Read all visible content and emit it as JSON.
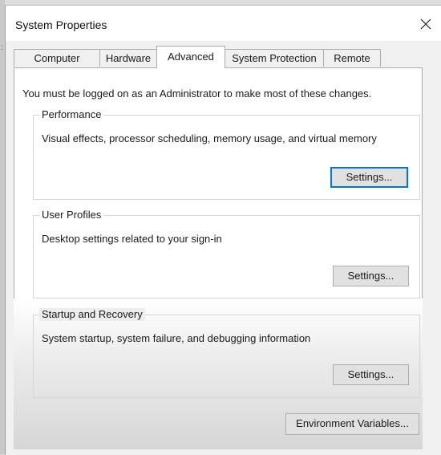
{
  "window": {
    "title": "System Properties",
    "close_icon": "close-icon"
  },
  "tabs": [
    {
      "label": "Computer Name",
      "active": false
    },
    {
      "label": "Hardware",
      "active": false
    },
    {
      "label": "Advanced",
      "active": true
    },
    {
      "label": "System Protection",
      "active": false
    },
    {
      "label": "Remote",
      "active": false
    }
  ],
  "advanced": {
    "admin_note": "You must be logged on as an Administrator to make most of these changes.",
    "performance": {
      "title": "Performance",
      "description": "Visual effects, processor scheduling, memory usage, and virtual memory",
      "settings_label": "Settings..."
    },
    "user_profiles": {
      "title": "User Profiles",
      "description": "Desktop settings related to your sign-in",
      "settings_label": "Settings..."
    },
    "startup_recovery": {
      "title": "Startup and Recovery",
      "description": "System startup, system failure, and debugging information",
      "settings_label": "Settings..."
    },
    "env_vars_label": "Environment Variables..."
  },
  "colors": {
    "focus_border": "#0078d7",
    "button_face": "#e1e1e1",
    "window_bg": "#f0f0f0"
  }
}
